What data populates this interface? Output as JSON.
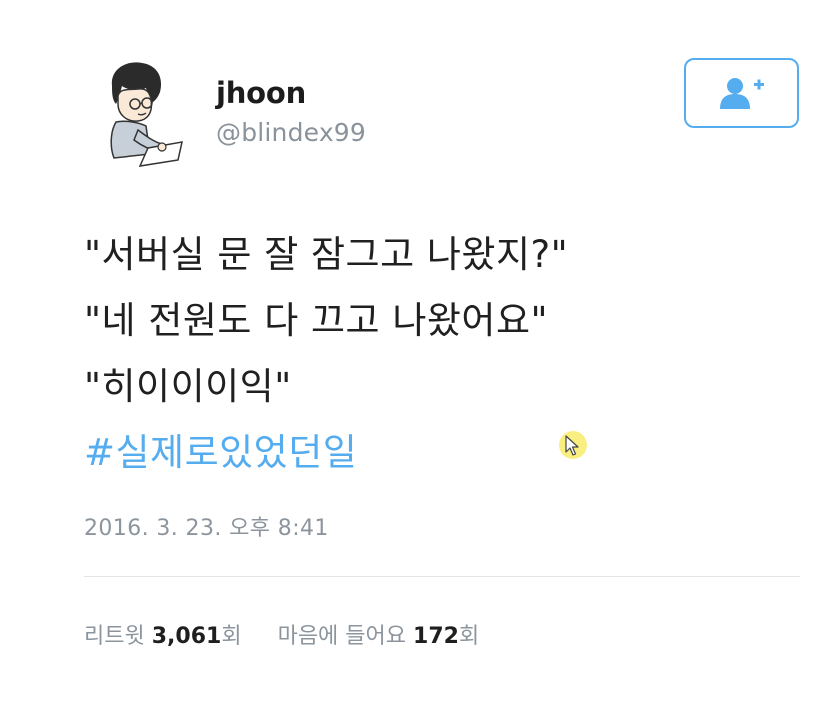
{
  "user": {
    "name": "jhoon",
    "handle": "@blindex99",
    "avatar_icon": "cartoon-man-avatar"
  },
  "follow_button": {
    "icon": "add-user-icon",
    "color": "#55acee"
  },
  "tweet": {
    "lines": [
      "\"서버실 문 잘 잠그고 나왔지?\"",
      "\"네 전원도 다 끄고 나왔어요\"",
      "\"히이이이익\""
    ],
    "hashtag": "#실제로있었던일",
    "hashtag_color": "#55acee"
  },
  "timestamp": "2016. 3. 23. 오후 8:41",
  "stats": {
    "retweet_label": "리트윗",
    "retweet_count": "3,061",
    "retweet_unit": "회",
    "like_label": "마음에 들어요",
    "like_count": "172",
    "like_unit": "회"
  }
}
